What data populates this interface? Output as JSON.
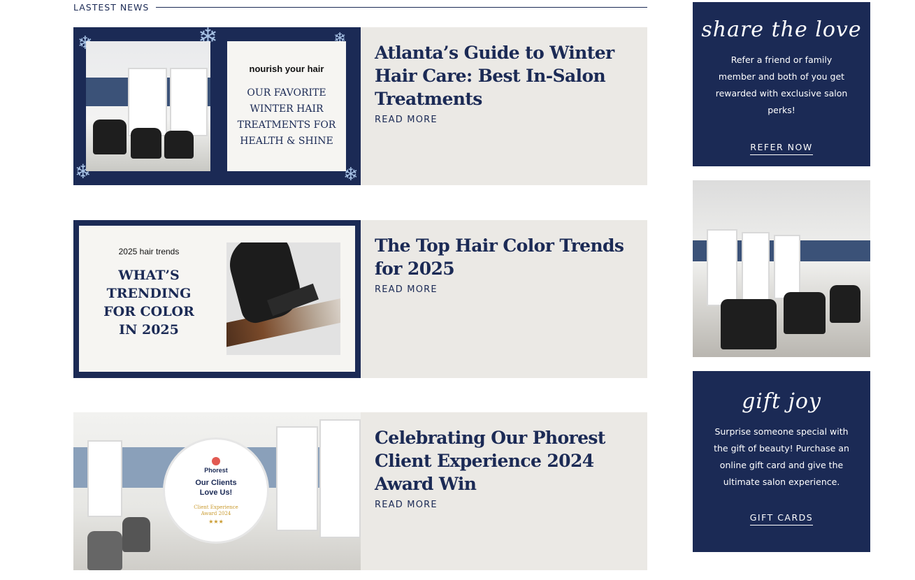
{
  "section": {
    "label": "LASTEST NEWS"
  },
  "posts": [
    {
      "title": "Atlanta’s Guide to Winter Hair Care: Best In-Salon Treatments",
      "read_more": "READ MORE",
      "thumb": {
        "kicker": "nourish your hair",
        "headline": "OUR FAVORITE WINTER HAIR TREATMENTS FOR HEALTH & SHINE"
      }
    },
    {
      "title": "The Top Hair Color Trends for 2025",
      "read_more": "READ MORE",
      "thumb": {
        "kicker": "2025 hair trends",
        "headline": "WHAT’S TRENDING FOR COLOR IN 2025"
      }
    },
    {
      "title": "Celebrating Our Phorest Client Experience 2024 Award Win",
      "read_more": "READ MORE",
      "thumb": {
        "badge_brand": "Phorest",
        "badge_text": "Our Clients Love Us!",
        "badge_sub": "Client Experience Award 2024"
      }
    }
  ],
  "sidebar": {
    "share": {
      "script_title": "share the love",
      "body": "Refer a friend or family member and both of you get rewarded with exclusive salon perks!",
      "link": "REFER NOW"
    },
    "gift": {
      "script_title": "gift joy",
      "body": "Surprise someone special with the gift of beauty! Purchase an online gift card and give the ultimate salon experience.",
      "link": "GIFT CARDS"
    }
  },
  "colors": {
    "navy": "#1b2a55",
    "card_bg": "#ebe9e5",
    "gold": "#c99a2e"
  }
}
